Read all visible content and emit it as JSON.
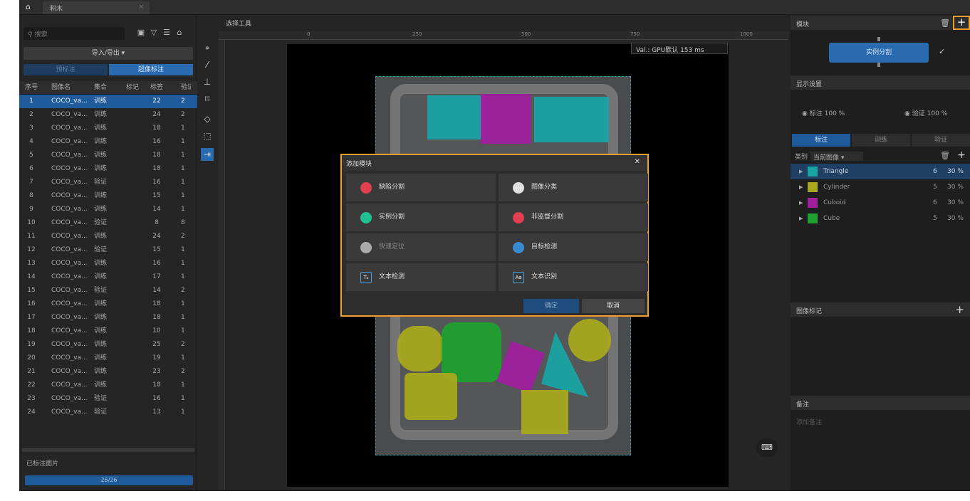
{
  "topbar": {
    "project_tab": "积木"
  },
  "left": {
    "search_placeholder": "搜索",
    "import_export": "导入/导出 ▾",
    "pre_label": "预标注",
    "super_label": "超像标注",
    "columns": [
      "序号",
      "图像名",
      "集合",
      "标记",
      "标签",
      "验证"
    ],
    "rows": [
      [
        "1",
        "COCO_va...",
        "训练",
        "",
        "22",
        "2"
      ],
      [
        "2",
        "COCO_va...",
        "训练",
        "",
        "24",
        "2"
      ],
      [
        "3",
        "COCO_va...",
        "训练",
        "",
        "18",
        "1"
      ],
      [
        "4",
        "COCO_va...",
        "训练",
        "",
        "16",
        "1"
      ],
      [
        "5",
        "COCO_va...",
        "训练",
        "",
        "18",
        "1"
      ],
      [
        "6",
        "COCO_va...",
        "训练",
        "",
        "18",
        "1"
      ],
      [
        "7",
        "COCO_va...",
        "验证",
        "",
        "16",
        "1"
      ],
      [
        "8",
        "COCO_va...",
        "训练",
        "",
        "15",
        "1"
      ],
      [
        "9",
        "COCO_va...",
        "训练",
        "",
        "14",
        "1"
      ],
      [
        "10",
        "COCO_va...",
        "验证",
        "",
        "8",
        "8"
      ],
      [
        "11",
        "COCO_va...",
        "训练",
        "",
        "24",
        "2"
      ],
      [
        "12",
        "COCO_va...",
        "验证",
        "",
        "15",
        "1"
      ],
      [
        "13",
        "COCO_va...",
        "训练",
        "",
        "16",
        "1"
      ],
      [
        "14",
        "COCO_va...",
        "训练",
        "",
        "17",
        "1"
      ],
      [
        "15",
        "COCO_va...",
        "验证",
        "",
        "14",
        "2"
      ],
      [
        "16",
        "COCO_va...",
        "训练",
        "",
        "18",
        "1"
      ],
      [
        "17",
        "COCO_va...",
        "训练",
        "",
        "18",
        "1"
      ],
      [
        "18",
        "COCO_va...",
        "训练",
        "",
        "10",
        "1"
      ],
      [
        "19",
        "COCO_va...",
        "训练",
        "",
        "25",
        "2"
      ],
      [
        "20",
        "COCO_va...",
        "训练",
        "",
        "19",
        "1"
      ],
      [
        "21",
        "COCO_va...",
        "训练",
        "",
        "23",
        "2"
      ],
      [
        "22",
        "COCO_va...",
        "训练",
        "",
        "18",
        "1"
      ],
      [
        "23",
        "COCO_va...",
        "验证",
        "",
        "16",
        "1"
      ],
      [
        "24",
        "COCO_va...",
        "验证",
        "",
        "13",
        "1"
      ]
    ],
    "labeled_title": "已标注图片",
    "progress_text": "26/26",
    "progress_fraction": 1.0
  },
  "center": {
    "header": "选择工具",
    "ruler": [
      "0",
      "250",
      "500",
      "750",
      "1000"
    ],
    "val_badge": "Val.: GPU默认 153 ms"
  },
  "right": {
    "module_title": "模块",
    "module_node": "实例分割",
    "display_title": "显示设置",
    "label_vis": "标注",
    "label_pct": "100 %",
    "verify_vis": "验证",
    "verify_pct": "100 %",
    "tabs": [
      "标注",
      "训练",
      "验证"
    ],
    "class_label": "类别",
    "class_filter": "当前图像",
    "classes": [
      {
        "name": "Triangle",
        "count": "6",
        "pct": "30 %",
        "color": "#1aa3a3"
      },
      {
        "name": "Cylinder",
        "count": "5",
        "pct": "30 %",
        "color": "#a8a820"
      },
      {
        "name": "Cuboid",
        "count": "6",
        "pct": "30 %",
        "color": "#a020a0"
      },
      {
        "name": "Cube",
        "count": "5",
        "pct": "30 %",
        "color": "#20a030"
      }
    ],
    "image_mark_title": "图像标记",
    "note_title": "备注",
    "note_placeholder": "添加备注"
  },
  "dialog": {
    "title": "添加模块",
    "options": [
      {
        "label": "缺陷分割",
        "icon": "defect-segmentation-icon"
      },
      {
        "label": "图像分类",
        "icon": "image-classification-icon"
      },
      {
        "label": "实例分割",
        "icon": "instance-segmentation-icon"
      },
      {
        "label": "非监督分割",
        "icon": "unsupervised-segmentation-icon"
      },
      {
        "label": "快速定位",
        "icon": "fast-locate-icon"
      },
      {
        "label": "目标检测",
        "icon": "object-detection-icon"
      },
      {
        "label": "文本检测",
        "icon": "text-detection-icon"
      },
      {
        "label": "文本识别",
        "icon": "text-recognition-icon"
      }
    ],
    "ok": "确定",
    "cancel": "取消"
  },
  "colors": {
    "accent": "#2a6bb0",
    "highlight": "#f0a030"
  }
}
